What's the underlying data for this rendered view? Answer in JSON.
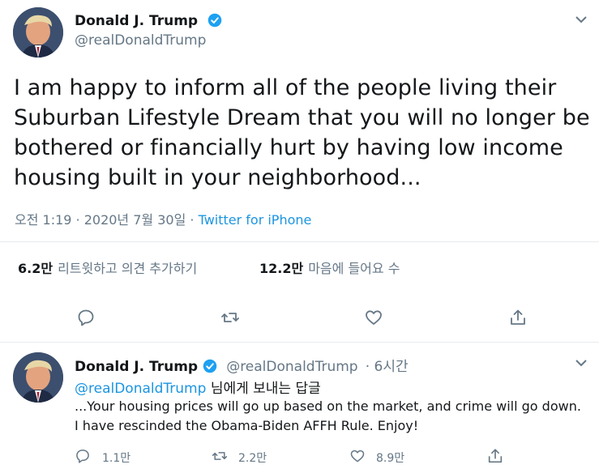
{
  "tweet": {
    "author_name": "Donald J. Trump",
    "author_handle": "@realDonaldTrump",
    "text": "I am happy to inform all of the people living their Suburban Lifestyle Dream that you will no longer be bothered or financially hurt by having low income housing built in your neighborhood...",
    "timestamp": "오전 1:19 · 2020년 7월 30일 · ",
    "source": "Twitter for iPhone",
    "retweets_count": "6.2만",
    "retweets_label": "리트윗하고 의견 추가하기",
    "likes_count": "12.2만",
    "likes_label": "마음에 들어요 수"
  },
  "reply": {
    "author_name": "Donald J. Trump",
    "author_handle": "@realDonaldTrump",
    "time_ago": "· 6시간",
    "replying_to_handle": "@realDonaldTrump",
    "replying_to_suffix": " 님에게 보내는 답글",
    "text": "...Your housing prices will go up based on the market, and crime will go down. I have rescinded the Obama-Biden AFFH Rule. Enjoy!",
    "reply_count": "1.1만",
    "retweet_count": "2.2만",
    "like_count": "8.9만"
  },
  "colors": {
    "accent": "#1da1f2",
    "link": "#1b95e0",
    "secondary_text": "#657786"
  }
}
